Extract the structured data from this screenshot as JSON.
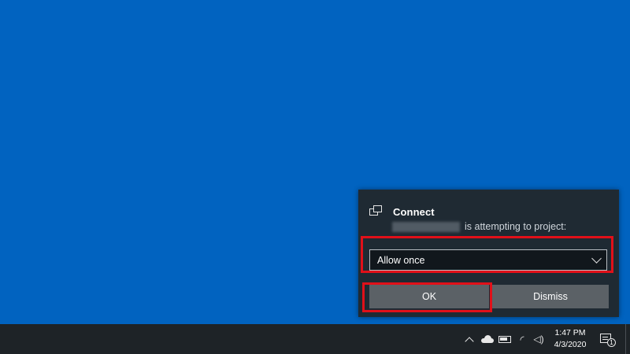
{
  "toast": {
    "title": "Connect",
    "message": "is attempting to project:",
    "select": {
      "selected": "Allow once"
    },
    "buttons": {
      "ok": "OK",
      "dismiss": "Dismiss"
    },
    "icon": "project-display-icon"
  },
  "taskbar": {
    "clock": {
      "time": "1:47 PM",
      "date": "4/3/2020"
    },
    "tray_icons": [
      "show-hidden-icons-icon",
      "onedrive-cloud-icon",
      "battery-icon",
      "network-icon",
      "volume-icon"
    ],
    "action_center_badge": "1"
  },
  "colors": {
    "desktop": "#0163c0",
    "toast_bg": "#1f2a33",
    "highlight": "#e11019",
    "button": "#5b6166",
    "taskbar": "#1e2327"
  }
}
